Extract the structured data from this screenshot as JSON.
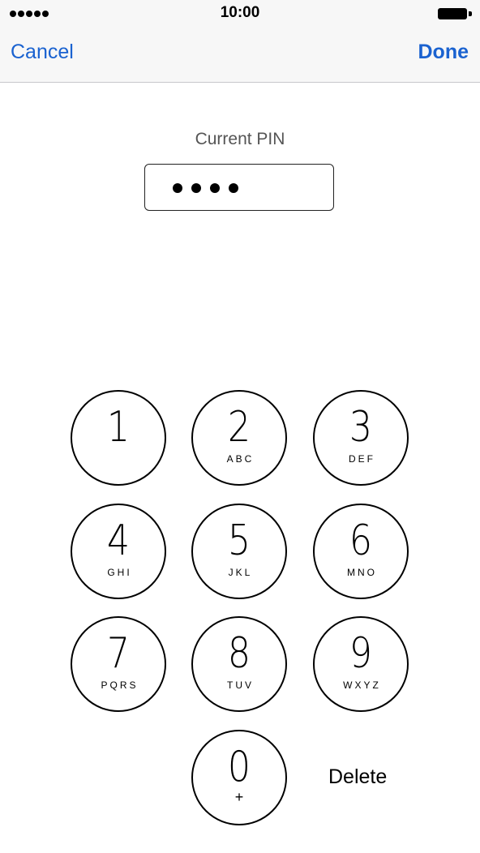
{
  "status_bar": {
    "time": "10:00",
    "signal_icon": "signal-dots-icon",
    "battery_icon": "battery-full-icon"
  },
  "nav": {
    "cancel_label": "Cancel",
    "done_label": "Done"
  },
  "pin": {
    "label": "Current PIN",
    "entered_digits": 4
  },
  "keypad": {
    "keys": [
      {
        "digit": "1",
        "letters": ""
      },
      {
        "digit": "2",
        "letters": "ABC"
      },
      {
        "digit": "3",
        "letters": "DEF"
      },
      {
        "digit": "4",
        "letters": "GHI"
      },
      {
        "digit": "5",
        "letters": "JKL"
      },
      {
        "digit": "6",
        "letters": "MNO"
      },
      {
        "digit": "7",
        "letters": "PQRS"
      },
      {
        "digit": "8",
        "letters": "TUV"
      },
      {
        "digit": "9",
        "letters": "WXYZ"
      },
      {
        "digit": "0",
        "letters": "+"
      }
    ],
    "delete_label": "Delete"
  },
  "colors": {
    "accent": "#1a62d0",
    "bar_background": "#f7f7f7"
  }
}
